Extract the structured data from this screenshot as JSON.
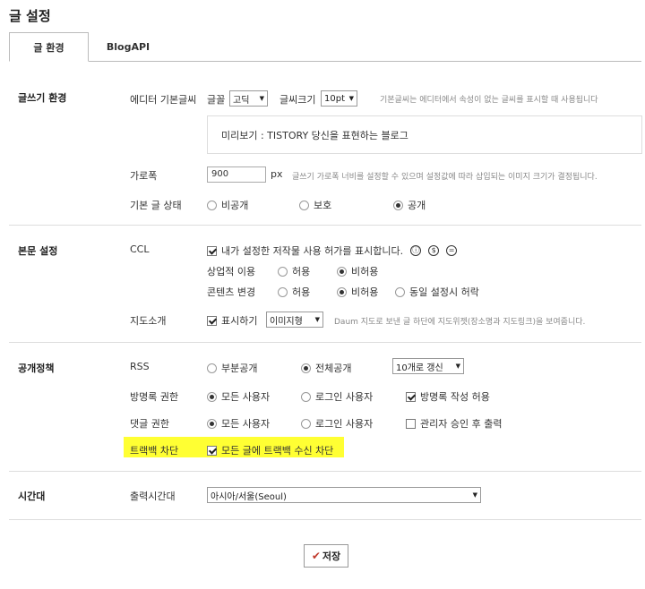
{
  "page_title": "글 설정",
  "tabs": [
    {
      "label": "글 환경"
    },
    {
      "label": "BlogAPI"
    }
  ],
  "sections": {
    "writing": {
      "title": "글쓰기 환경",
      "editor_font": {
        "label": "에디터 기본글씨",
        "font_label": "글꼴",
        "font_value": "고딕",
        "size_label": "글씨크기",
        "size_value": "10pt",
        "hint": "기본글씨는 에디터에서 속성이 없는 글씨를 표시할 때 사용됩니다"
      },
      "preview": "미리보기 : TISTORY 당신을 표현하는 블로그",
      "width": {
        "label": "가로폭",
        "value": "900",
        "unit": "px",
        "hint": "글쓰기 가로폭 너비를 설정할 수 있으며 설정값에 따라 삽입되는 이미지 크기가 결정됩니다."
      },
      "default_state": {
        "label": "기본 글 상태",
        "options": [
          "비공개",
          "보호",
          "공개"
        ],
        "selected": "공개"
      }
    },
    "body": {
      "title": "본문 설정",
      "ccl": {
        "label": "CCL",
        "checkbox_label": "내가 설정한 저작물 사용 허가를 표시합니다.",
        "icons": [
          "ⓘ",
          "$",
          "="
        ],
        "commercial_label": "상업적 이용",
        "commercial_options": [
          "허용",
          "비허용"
        ],
        "commercial_selected": "비허용",
        "modify_label": "콘텐츠 변경",
        "modify_options": [
          "허용",
          "비허용",
          "동일 설정시 허락"
        ],
        "modify_selected": "비허용"
      },
      "map": {
        "label": "지도소개",
        "checkbox_label": "표시하기",
        "select_value": "이미지형",
        "hint": "Daum 지도로 보낸 글 하단에 지도위젯(장소명과 지도링크)을 보여줍니다."
      }
    },
    "public": {
      "title": "공개정책",
      "rss": {
        "label": "RSS",
        "options": [
          "부분공개",
          "전체공개"
        ],
        "selected": "전체공개",
        "select_value": "10개로 갱신"
      },
      "guestbook": {
        "label": "방명록 권한",
        "options": [
          "모든 사용자",
          "로그인 사용자"
        ],
        "selected": "모든 사용자",
        "checkbox_label": "방명록 작성 허용"
      },
      "comment": {
        "label": "댓글 권한",
        "options": [
          "모든 사용자",
          "로그인 사용자"
        ],
        "selected": "모든 사용자",
        "checkbox_label": "관리자 승인 후 출력"
      },
      "trackback": {
        "label": "트랙백 차단",
        "checkbox_label": "모든 글에 트랙백 수신 차단",
        "highlight_color": "#ffff33"
      }
    },
    "timezone": {
      "title": "시간대",
      "label": "출력시간대",
      "select_value": "아시아/서울(Seoul)"
    }
  },
  "save_button": {
    "label": "저장",
    "icon": "check-icon",
    "icon_color": "#c0392b"
  }
}
